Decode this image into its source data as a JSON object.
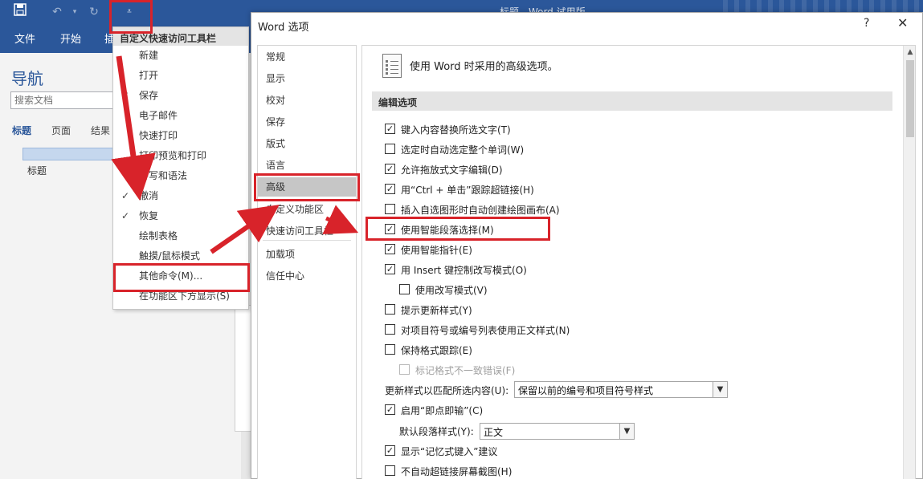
{
  "ribbon": {
    "title": "标题 - Word 试用版",
    "tabs": [
      "文件",
      "开始",
      "插"
    ],
    "qat_icons": [
      "save-icon",
      "undo-icon",
      "redo-icon",
      "customize-qat-icon"
    ]
  },
  "nav": {
    "title": "导航",
    "search_placeholder": "搜索文档",
    "tabs": [
      "标题",
      "页面",
      "结果"
    ],
    "heading_item": "标题"
  },
  "qat_menu": {
    "header": "自定义快速访问工具栏",
    "items": [
      {
        "label": "新建",
        "checked": false
      },
      {
        "label": "打开",
        "checked": false
      },
      {
        "label": "保存",
        "checked": true
      },
      {
        "label": "电子邮件",
        "checked": false
      },
      {
        "label": "快速打印",
        "checked": false
      },
      {
        "label": "打印预览和打印",
        "checked": false
      },
      {
        "label": "拼写和语法",
        "checked": false
      },
      {
        "label": "撤消",
        "checked": true
      },
      {
        "label": "恢复",
        "checked": true
      },
      {
        "label": "绘制表格",
        "checked": false
      },
      {
        "label": "触摸/鼠标模式",
        "checked": false
      },
      {
        "label": "其他命令(M)...",
        "checked": false
      },
      {
        "label": "在功能区下方显示(S)",
        "checked": false
      }
    ]
  },
  "dialog": {
    "title": "Word 选项",
    "help": "?",
    "close": "✕",
    "categories": [
      "常规",
      "显示",
      "校对",
      "保存",
      "版式",
      "语言",
      "高级",
      "自定义功能区",
      "快速访问工具栏",
      "加载项",
      "信任中心"
    ],
    "selected_category": "高级",
    "heading": "使用 Word 时采用的高级选项。",
    "section": "编辑选项",
    "options": [
      {
        "label": "键入内容替换所选文字(T)",
        "checked": true,
        "indent": false,
        "disabled": false
      },
      {
        "label": "选定时自动选定整个单词(W)",
        "checked": false,
        "indent": false,
        "disabled": false
      },
      {
        "label": "允许拖放式文字编辑(D)",
        "checked": true,
        "indent": false,
        "disabled": false
      },
      {
        "label": "用“Ctrl + 单击”跟踪超链接(H)",
        "checked": true,
        "indent": false,
        "disabled": false
      },
      {
        "label": "插入自选图形时自动创建绘图画布(A)",
        "checked": false,
        "indent": false,
        "disabled": false
      },
      {
        "label": "使用智能段落选择(M)",
        "checked": true,
        "indent": false,
        "disabled": false
      },
      {
        "label": "使用智能指针(E)",
        "checked": true,
        "indent": false,
        "disabled": false
      },
      {
        "label": "用 Insert 键控制改写模式(O)",
        "checked": true,
        "indent": false,
        "disabled": false
      },
      {
        "label": "使用改写模式(V)",
        "checked": false,
        "indent": true,
        "disabled": false
      },
      {
        "label": "提示更新样式(Y)",
        "checked": false,
        "indent": false,
        "disabled": false
      },
      {
        "label": "对项目符号或编号列表使用正文样式(N)",
        "checked": false,
        "indent": false,
        "disabled": false
      },
      {
        "label": "保持格式跟踪(E)",
        "checked": false,
        "indent": false,
        "disabled": false
      },
      {
        "label": "标记格式不一致错误(F)",
        "checked": false,
        "indent": true,
        "disabled": true
      }
    ],
    "style_update": {
      "label": "更新样式以匹配所选内容(U):",
      "value": "保留以前的编号和项目符号样式"
    },
    "click_type": {
      "label": "启用“即点即输”(C)",
      "checked": true
    },
    "default_para": {
      "label": "默认段落样式(Y):",
      "value": "正文"
    },
    "autocomplete": {
      "label": "显示“记忆式键入”建议",
      "checked": true
    },
    "no_autolink": {
      "label": "不自动超链接屏幕截图(H)",
      "checked": false
    }
  },
  "annotation_color": "#d8232a"
}
